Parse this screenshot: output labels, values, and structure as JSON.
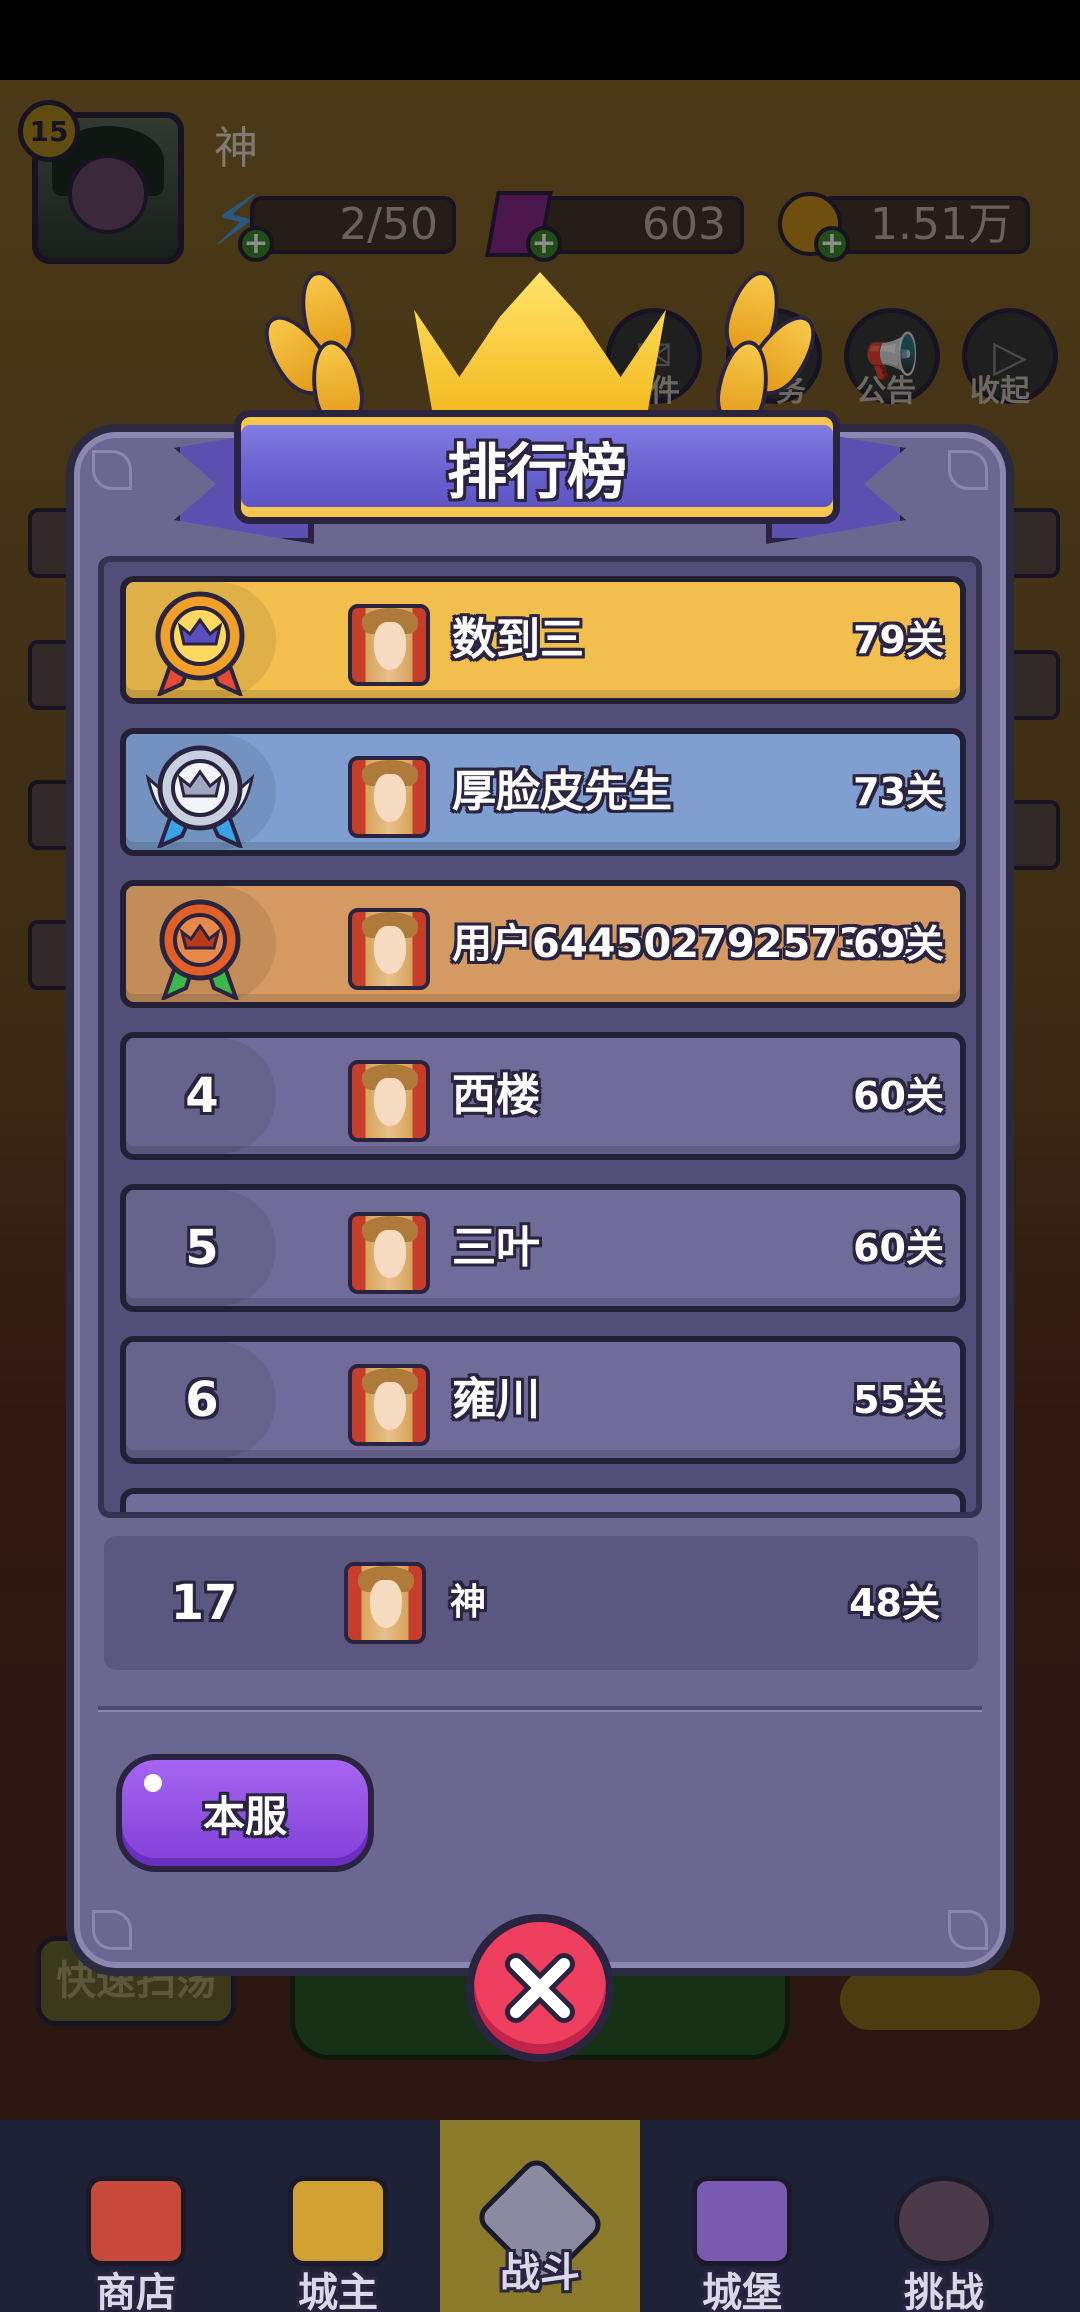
{
  "player": {
    "level": "15",
    "name": "神",
    "energy": "2/50",
    "gems": "603",
    "gold": "1.51万"
  },
  "side_buttons": {
    "mail_label": "件",
    "task_label": "务",
    "notice_label": "公告",
    "collapse_label": "收起"
  },
  "leaderboard": {
    "title": "排行榜",
    "rows": [
      {
        "rank": "1",
        "name": "数到三",
        "score": "79关",
        "tier": "gold"
      },
      {
        "rank": "2",
        "name": "厚脸皮先生",
        "score": "73关",
        "tier": "silver"
      },
      {
        "rank": "3",
        "name": "用户64450279257361",
        "score": "69关",
        "tier": "bronze"
      },
      {
        "rank": "4",
        "name": "西楼",
        "score": "60关",
        "tier": "plain"
      },
      {
        "rank": "5",
        "name": "三叶",
        "score": "60关",
        "tier": "plain"
      },
      {
        "rank": "6",
        "name": "雍川",
        "score": "55关",
        "tier": "plain"
      }
    ],
    "self": {
      "rank": "17",
      "name": "神",
      "score": "48关"
    },
    "server_button": "本服"
  },
  "background": {
    "quick_sweep": "快速扫荡"
  },
  "bottom_nav": [
    {
      "label": "商店"
    },
    {
      "label": "城主"
    },
    {
      "label": "战斗"
    },
    {
      "label": "城堡"
    },
    {
      "label": "挑战"
    }
  ],
  "colors": {
    "gold_row": "#f2bf4e",
    "silver_row": "#7e9fd0",
    "bronze_row": "#d49a62",
    "plain_row": "#6f6c99",
    "close_button": "#ef3f5e",
    "server_button": "#9a55e8"
  }
}
